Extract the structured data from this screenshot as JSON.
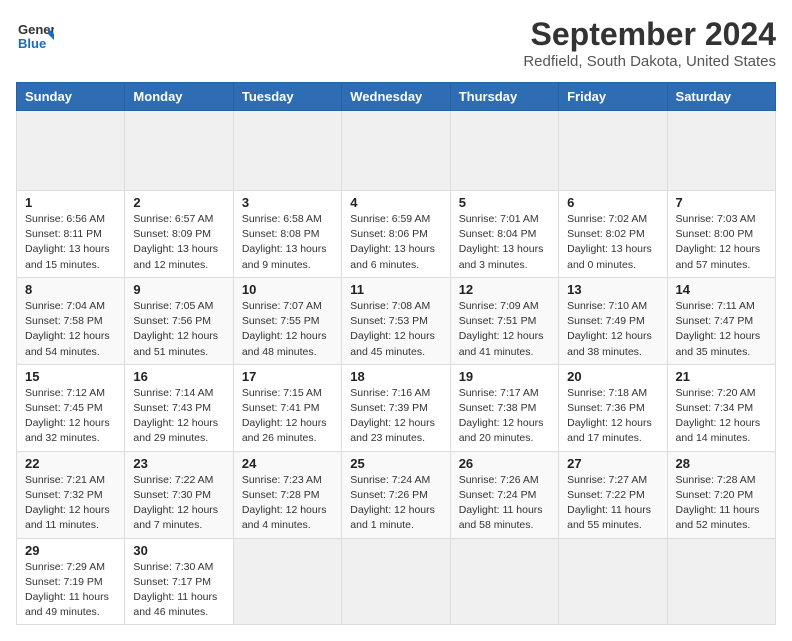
{
  "header": {
    "logo_line1": "General",
    "logo_line2": "Blue",
    "title": "September 2024",
    "subtitle": "Redfield, South Dakota, United States"
  },
  "calendar": {
    "days_of_week": [
      "Sunday",
      "Monday",
      "Tuesday",
      "Wednesday",
      "Thursday",
      "Friday",
      "Saturday"
    ],
    "weeks": [
      [
        {
          "day": null,
          "info": ""
        },
        {
          "day": null,
          "info": ""
        },
        {
          "day": null,
          "info": ""
        },
        {
          "day": null,
          "info": ""
        },
        {
          "day": null,
          "info": ""
        },
        {
          "day": null,
          "info": ""
        },
        {
          "day": null,
          "info": ""
        }
      ],
      [
        {
          "day": 1,
          "info": "Sunrise: 6:56 AM\nSunset: 8:11 PM\nDaylight: 13 hours\nand 15 minutes."
        },
        {
          "day": 2,
          "info": "Sunrise: 6:57 AM\nSunset: 8:09 PM\nDaylight: 13 hours\nand 12 minutes."
        },
        {
          "day": 3,
          "info": "Sunrise: 6:58 AM\nSunset: 8:08 PM\nDaylight: 13 hours\nand 9 minutes."
        },
        {
          "day": 4,
          "info": "Sunrise: 6:59 AM\nSunset: 8:06 PM\nDaylight: 13 hours\nand 6 minutes."
        },
        {
          "day": 5,
          "info": "Sunrise: 7:01 AM\nSunset: 8:04 PM\nDaylight: 13 hours\nand 3 minutes."
        },
        {
          "day": 6,
          "info": "Sunrise: 7:02 AM\nSunset: 8:02 PM\nDaylight: 13 hours\nand 0 minutes."
        },
        {
          "day": 7,
          "info": "Sunrise: 7:03 AM\nSunset: 8:00 PM\nDaylight: 12 hours\nand 57 minutes."
        }
      ],
      [
        {
          "day": 8,
          "info": "Sunrise: 7:04 AM\nSunset: 7:58 PM\nDaylight: 12 hours\nand 54 minutes."
        },
        {
          "day": 9,
          "info": "Sunrise: 7:05 AM\nSunset: 7:56 PM\nDaylight: 12 hours\nand 51 minutes."
        },
        {
          "day": 10,
          "info": "Sunrise: 7:07 AM\nSunset: 7:55 PM\nDaylight: 12 hours\nand 48 minutes."
        },
        {
          "day": 11,
          "info": "Sunrise: 7:08 AM\nSunset: 7:53 PM\nDaylight: 12 hours\nand 45 minutes."
        },
        {
          "day": 12,
          "info": "Sunrise: 7:09 AM\nSunset: 7:51 PM\nDaylight: 12 hours\nand 41 minutes."
        },
        {
          "day": 13,
          "info": "Sunrise: 7:10 AM\nSunset: 7:49 PM\nDaylight: 12 hours\nand 38 minutes."
        },
        {
          "day": 14,
          "info": "Sunrise: 7:11 AM\nSunset: 7:47 PM\nDaylight: 12 hours\nand 35 minutes."
        }
      ],
      [
        {
          "day": 15,
          "info": "Sunrise: 7:12 AM\nSunset: 7:45 PM\nDaylight: 12 hours\nand 32 minutes."
        },
        {
          "day": 16,
          "info": "Sunrise: 7:14 AM\nSunset: 7:43 PM\nDaylight: 12 hours\nand 29 minutes."
        },
        {
          "day": 17,
          "info": "Sunrise: 7:15 AM\nSunset: 7:41 PM\nDaylight: 12 hours\nand 26 minutes."
        },
        {
          "day": 18,
          "info": "Sunrise: 7:16 AM\nSunset: 7:39 PM\nDaylight: 12 hours\nand 23 minutes."
        },
        {
          "day": 19,
          "info": "Sunrise: 7:17 AM\nSunset: 7:38 PM\nDaylight: 12 hours\nand 20 minutes."
        },
        {
          "day": 20,
          "info": "Sunrise: 7:18 AM\nSunset: 7:36 PM\nDaylight: 12 hours\nand 17 minutes."
        },
        {
          "day": 21,
          "info": "Sunrise: 7:20 AM\nSunset: 7:34 PM\nDaylight: 12 hours\nand 14 minutes."
        }
      ],
      [
        {
          "day": 22,
          "info": "Sunrise: 7:21 AM\nSunset: 7:32 PM\nDaylight: 12 hours\nand 11 minutes."
        },
        {
          "day": 23,
          "info": "Sunrise: 7:22 AM\nSunset: 7:30 PM\nDaylight: 12 hours\nand 7 minutes."
        },
        {
          "day": 24,
          "info": "Sunrise: 7:23 AM\nSunset: 7:28 PM\nDaylight: 12 hours\nand 4 minutes."
        },
        {
          "day": 25,
          "info": "Sunrise: 7:24 AM\nSunset: 7:26 PM\nDaylight: 12 hours\nand 1 minute."
        },
        {
          "day": 26,
          "info": "Sunrise: 7:26 AM\nSunset: 7:24 PM\nDaylight: 11 hours\nand 58 minutes."
        },
        {
          "day": 27,
          "info": "Sunrise: 7:27 AM\nSunset: 7:22 PM\nDaylight: 11 hours\nand 55 minutes."
        },
        {
          "day": 28,
          "info": "Sunrise: 7:28 AM\nSunset: 7:20 PM\nDaylight: 11 hours\nand 52 minutes."
        }
      ],
      [
        {
          "day": 29,
          "info": "Sunrise: 7:29 AM\nSunset: 7:19 PM\nDaylight: 11 hours\nand 49 minutes."
        },
        {
          "day": 30,
          "info": "Sunrise: 7:30 AM\nSunset: 7:17 PM\nDaylight: 11 hours\nand 46 minutes."
        },
        {
          "day": null,
          "info": ""
        },
        {
          "day": null,
          "info": ""
        },
        {
          "day": null,
          "info": ""
        },
        {
          "day": null,
          "info": ""
        },
        {
          "day": null,
          "info": ""
        }
      ]
    ]
  }
}
